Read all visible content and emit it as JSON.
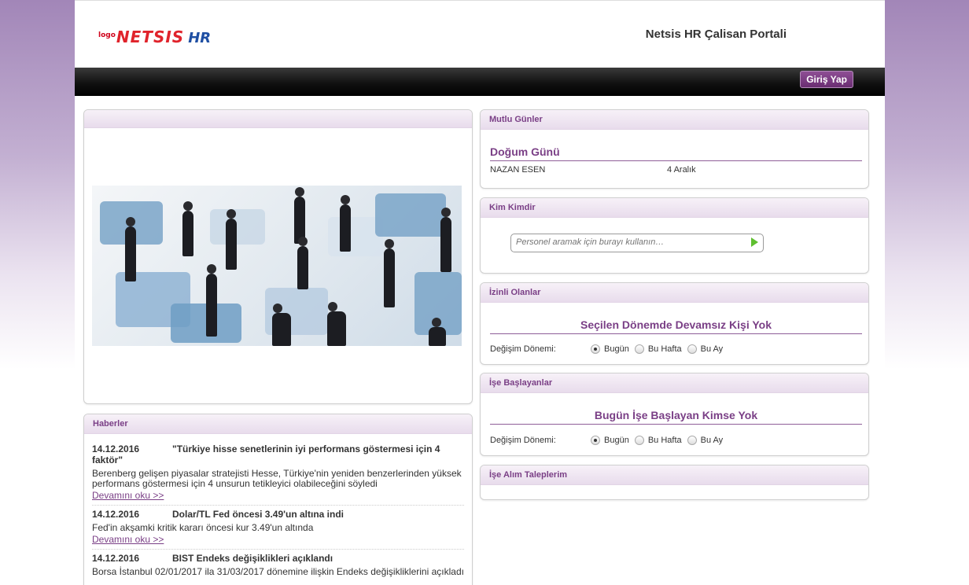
{
  "header": {
    "logo_small": "logo",
    "logo_netsis": "NETSIS",
    "logo_hr": "HR",
    "portal_title": "Netsis HR Çalisan Portali"
  },
  "nav": {
    "login_label": "Giriş Yap"
  },
  "mutlu_gunler": {
    "title": "Mutlu Günler",
    "section_title": "Doğum Günü",
    "rows": [
      {
        "name": "NAZAN ESEN",
        "date": "4 Aralık"
      }
    ]
  },
  "kim_kimdir": {
    "title": "Kim Kimdir",
    "search_placeholder": "Personel aramak için burayı kullanın…"
  },
  "izinli": {
    "title": "İzinli Olanlar",
    "message": "Seçilen Dönemde Devamsız Kişi Yok",
    "period_label": "Değişim Dönemi:",
    "options": [
      "Bugün",
      "Bu Hafta",
      "Bu Ay"
    ],
    "selected": "Bugün"
  },
  "ise_baslayanlar": {
    "title": "İşe Başlayanlar",
    "message": "Bugün İşe Başlayan Kimse Yok",
    "period_label": "Değişim Dönemi:",
    "options": [
      "Bugün",
      "Bu Hafta",
      "Bu Ay"
    ],
    "selected": "Bugün"
  },
  "ise_alim": {
    "title": "İşe Alım Taleplerim"
  },
  "haberler": {
    "title": "Haberler",
    "items": [
      {
        "date": "14.12.2016",
        "title": "\"Türkiye hisse senetlerinin iyi performans göstermesi için 4 faktör\"",
        "body": "Berenberg gelişen piyasalar stratejisti Hesse, Türkiye'nin yeniden benzerlerinden yüksek performans göstermesi için 4 unsurun tetikleyici olabileceğini söyledi",
        "more": "Devamını oku >>"
      },
      {
        "date": "14.12.2016",
        "title": "Dolar/TL Fed öncesi 3.49'un altına indi",
        "body": "Fed'in akşamki kritik kararı öncesi kur 3.49'un altında",
        "more": "Devamını oku >>"
      },
      {
        "date": "14.12.2016",
        "title": "BIST Endeks değişiklikleri açıklandı",
        "body": "Borsa İstanbul 02/01/2017 ila 31/03/2017 dönemine ilişkin Endeks değişikliklerini açıkladı",
        "more": ""
      }
    ]
  }
}
